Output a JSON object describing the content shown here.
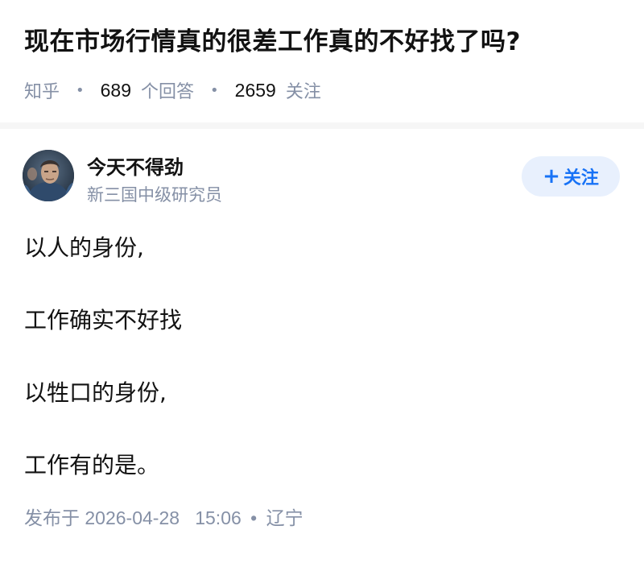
{
  "question": {
    "title": "现在市场行情真的很差工作真的不好找了吗?",
    "source": "知乎",
    "answer_count": "689",
    "answer_label": "个回答",
    "follower_count": "2659",
    "follower_label": "关注"
  },
  "answer": {
    "author": {
      "name": "今天不得劲",
      "headline": "新三国中级研究员",
      "avatar_icon": "avatar-portrait"
    },
    "follow_button": {
      "icon": "plus-icon",
      "plus": "+",
      "label": "关注",
      "color": "#1772f6",
      "background": "#e8f0fd"
    },
    "content": [
      "以人的身份,",
      "工作确实不好找",
      "以牲口的身份,",
      "工作有的是。"
    ],
    "publish": {
      "prefix": "发布于",
      "date": "2026-04-28",
      "time": "15:06",
      "separator": "•",
      "location": "辽宁"
    }
  },
  "colors": {
    "text": "#121212",
    "muted": "#8590a6",
    "accent": "#1772f6"
  }
}
